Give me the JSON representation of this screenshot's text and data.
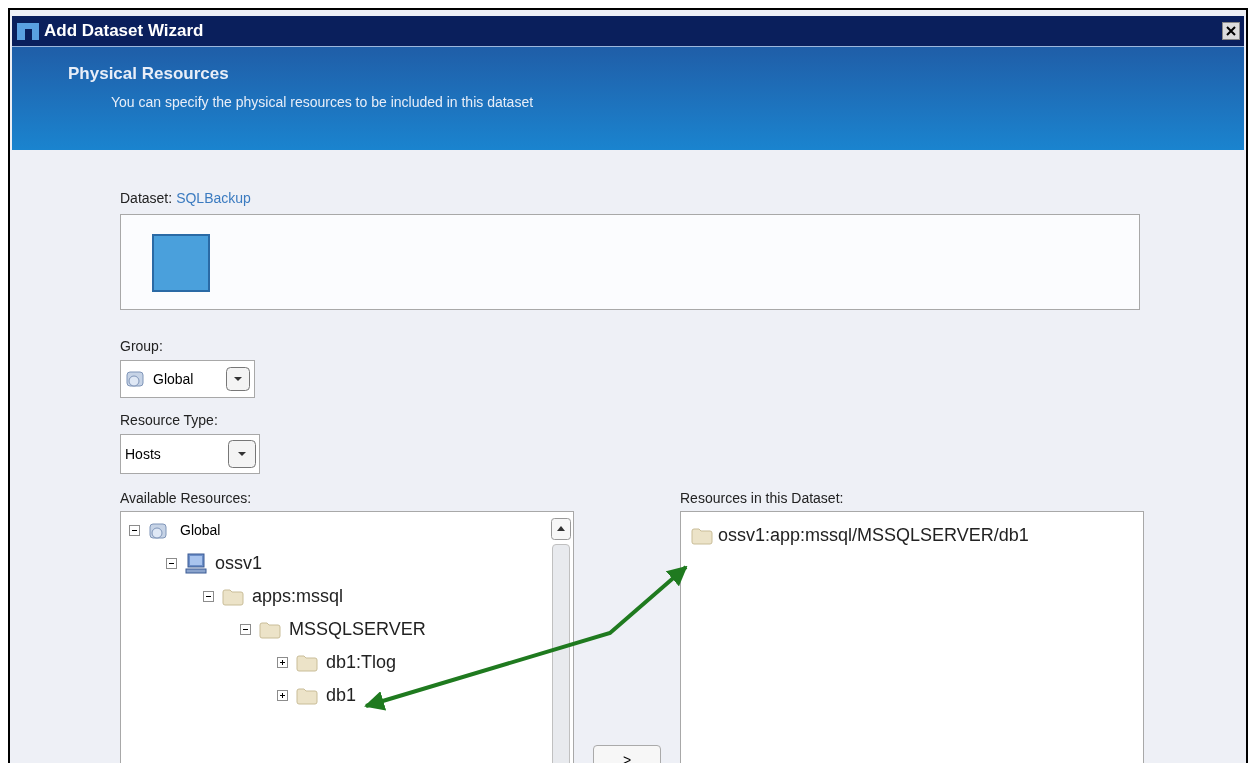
{
  "window": {
    "title": "Add Dataset Wizard"
  },
  "header": {
    "title": "Physical Resources",
    "subtitle": "You can specify the physical resources to be included in this dataset"
  },
  "dataset": {
    "label": "Dataset:",
    "name": "SQLBackup"
  },
  "group": {
    "label": "Group:",
    "value": "Global"
  },
  "resource_type": {
    "label": "Resource Type:",
    "value": "Hosts"
  },
  "available": {
    "label": "Available Resources:",
    "tree": [
      {
        "label": "Global",
        "kind": "group",
        "expanded": true,
        "children": [
          {
            "label": "ossv1",
            "kind": "host",
            "expanded": true,
            "children": [
              {
                "label": "apps:mssql",
                "kind": "folder",
                "expanded": true,
                "children": [
                  {
                    "label": "MSSQLSERVER",
                    "kind": "folder",
                    "expanded": true,
                    "children": [
                      {
                        "label": "db1:Tlog",
                        "kind": "folder",
                        "expanded": false
                      },
                      {
                        "label": "db1",
                        "kind": "folder",
                        "expanded": false
                      }
                    ]
                  }
                ]
              }
            ]
          }
        ]
      }
    ]
  },
  "add_button": ">",
  "selected": {
    "label": "Resources in this Dataset:",
    "items": [
      "ossv1:app:mssql/MSSQLSERVER/db1"
    ]
  }
}
